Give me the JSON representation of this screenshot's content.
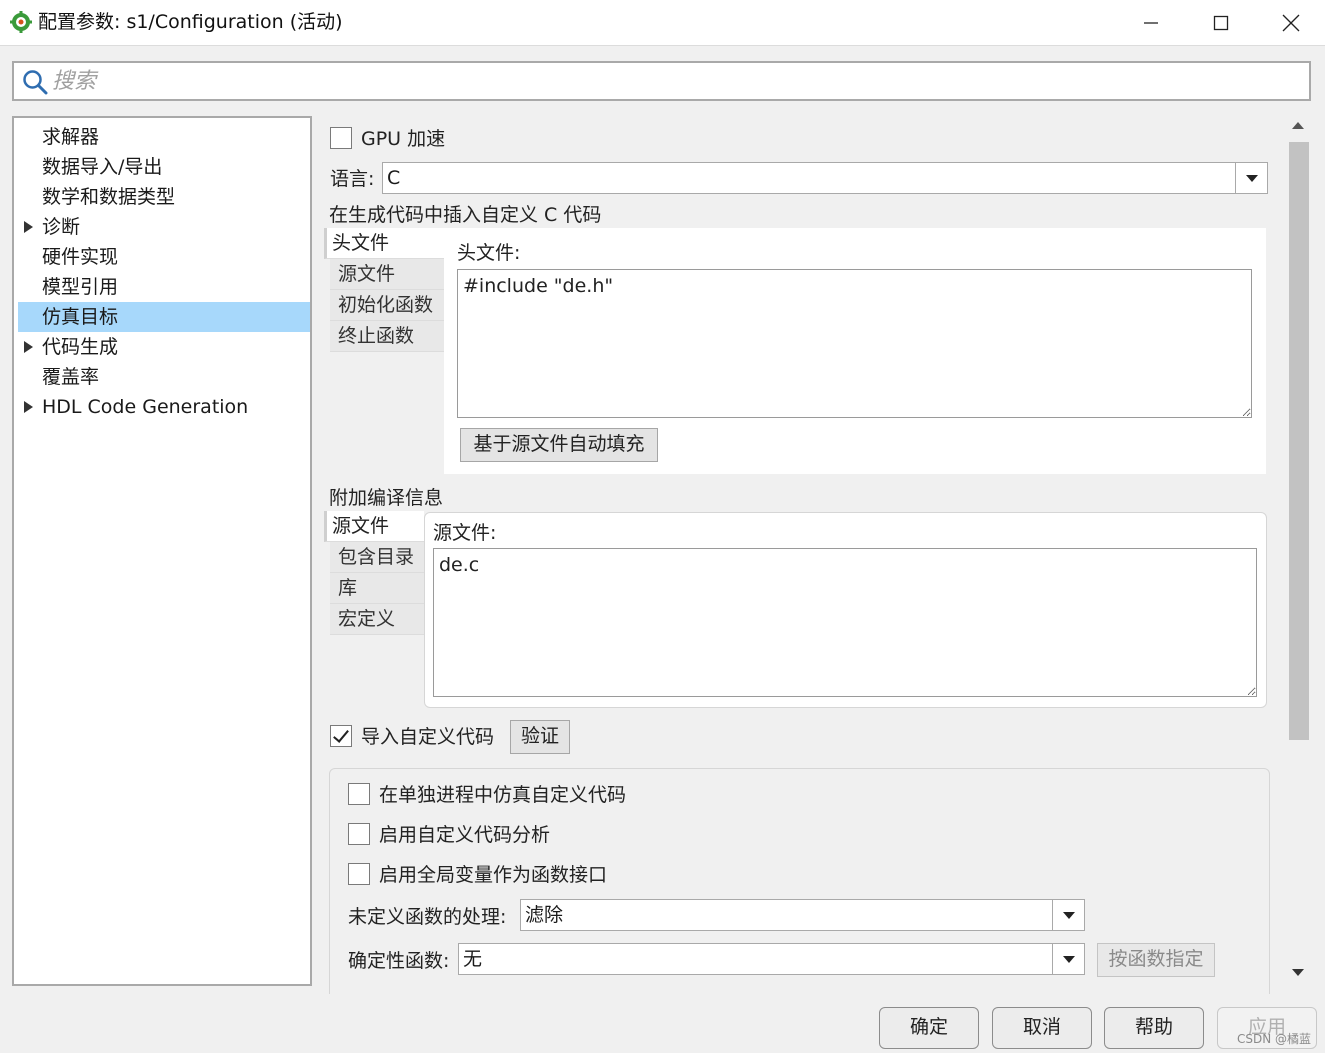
{
  "window": {
    "title": "配置参数: s1/Configuration (活动)"
  },
  "search": {
    "placeholder": "搜索",
    "value": ""
  },
  "tree": {
    "items": [
      {
        "label": "求解器",
        "expandable": false,
        "selected": false
      },
      {
        "label": "数据导入/导出",
        "expandable": false,
        "selected": false
      },
      {
        "label": "数学和数据类型",
        "expandable": false,
        "selected": false
      },
      {
        "label": "诊断",
        "expandable": true,
        "selected": false
      },
      {
        "label": "硬件实现",
        "expandable": false,
        "selected": false
      },
      {
        "label": "模型引用",
        "expandable": false,
        "selected": false
      },
      {
        "label": "仿真目标",
        "expandable": false,
        "selected": true
      },
      {
        "label": "代码生成",
        "expandable": true,
        "selected": false
      },
      {
        "label": "覆盖率",
        "expandable": false,
        "selected": false
      },
      {
        "label": "HDL Code Generation",
        "expandable": true,
        "selected": false
      }
    ]
  },
  "content": {
    "gpu_label": "GPU 加速",
    "gpu_checked": false,
    "language_label": "语言:",
    "language_value": "C",
    "custom_code_heading": "在生成代码中插入自定义 C 代码",
    "custom_code_tabs": [
      "头文件",
      "源文件",
      "初始化函数",
      "终止函数"
    ],
    "custom_code_active_tab": "头文件",
    "header_field_label": "头文件:",
    "header_field_value": "#include \"de.h\"",
    "autofill_button": "基于源文件自动填充",
    "build_info_heading": "附加编译信息",
    "build_info_tabs": [
      "源文件",
      "包含目录",
      "库",
      "宏定义"
    ],
    "build_info_active_tab": "源文件",
    "source_field_label": "源文件:",
    "source_field_value": "de.c",
    "import_custom_label": "导入自定义代码",
    "import_custom_checked": true,
    "validate_button": "验证",
    "separate_process_label": "在单独进程中仿真自定义代码",
    "code_analysis_label": "启用自定义代码分析",
    "global_vars_label": "启用全局变量作为函数接口",
    "undefined_fn_label": "未定义函数的处理:",
    "undefined_fn_value": "滤除",
    "deterministic_fn_label": "确定性函数:",
    "deterministic_fn_value": "无",
    "by_function_button": "按函数指定"
  },
  "footer": {
    "ok": "确定",
    "cancel": "取消",
    "help": "帮助",
    "apply": "应用",
    "watermark": "CSDN @橘蓝"
  },
  "colors": {
    "selection": "#a7d8fb",
    "app_icon": "#3a9a3a"
  }
}
